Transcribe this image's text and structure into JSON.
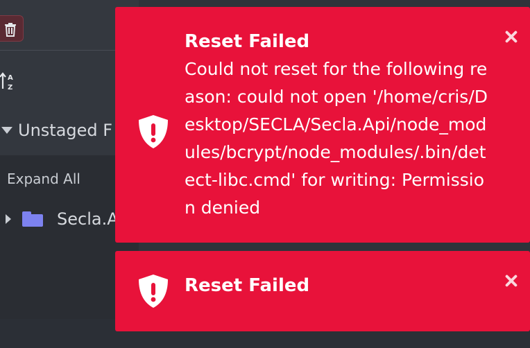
{
  "left_panel": {
    "trash_icon": "trash-icon",
    "sort_icon": "sort-az-icon",
    "section_label": "Unstaged F",
    "expand_all_label": "Expand All",
    "tree_item_label": "Secla.A"
  },
  "toasts": [
    {
      "title": "Reset Failed",
      "message": "Could not reset for the following reason: could not open '/home/cris/Desktop/SECLA/Secla.Api/node_modules/bcrypt/node_modules/.bin/detect-libc.cmd' for writing: Permission denied",
      "icon": "shield-exclamation-icon",
      "close_icon": "close-icon"
    },
    {
      "title": "Reset Failed",
      "icon": "shield-exclamation-icon",
      "close_icon": "close-icon"
    }
  ],
  "colors": {
    "toast_bg": "#e8123a",
    "panel_bg": "#33373e",
    "folder": "#7d82f0"
  }
}
